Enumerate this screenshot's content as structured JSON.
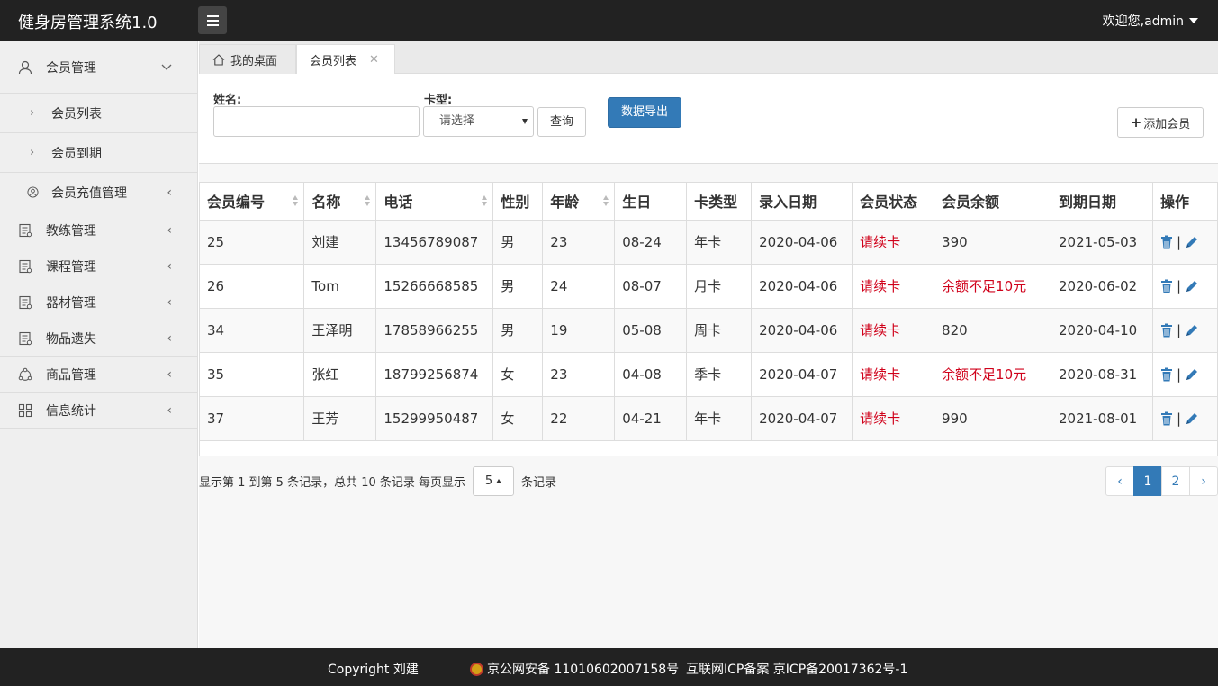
{
  "app": {
    "title": "健身房管理系统1.0",
    "user_greeting": "欢迎您,admin"
  },
  "sidebar": {
    "member": {
      "label": "会员管理",
      "children": [
        "会员列表",
        "会员到期",
        "会员充值管理"
      ]
    },
    "items": [
      {
        "label": "教练管理",
        "icon": "document-icon"
      },
      {
        "label": "课程管理",
        "icon": "document-icon"
      },
      {
        "label": "器材管理",
        "icon": "document-icon"
      },
      {
        "label": "物品遗失",
        "icon": "document-icon"
      },
      {
        "label": "商品管理",
        "icon": "refresh-icon"
      },
      {
        "label": "信息统计",
        "icon": "grid-icon"
      }
    ]
  },
  "tabs": [
    {
      "label": "我的桌面",
      "icon": "home-icon"
    },
    {
      "label": "会员列表",
      "active": true
    }
  ],
  "search": {
    "name_label": "姓名:",
    "name_value": "",
    "card_label": "卡型:",
    "card_selected": "请选择",
    "query_label": "查询",
    "export_label": "数据导出",
    "add_label": "添加会员"
  },
  "table": {
    "columns": [
      "会员编号",
      "名称",
      "电话",
      "性别",
      "年龄",
      "生日",
      "卡类型",
      "录入日期",
      "会员状态",
      "会员余额",
      "到期日期",
      "操作"
    ],
    "rows": [
      {
        "id": "25",
        "name": "刘建",
        "phone": "13456789087",
        "gender": "男",
        "age": "23",
        "birthday": "08-24",
        "card": "年卡",
        "entry": "2020-04-06",
        "status": "请续卡",
        "balance": "390",
        "balance_warn": false,
        "expire": "2021-05-03"
      },
      {
        "id": "26",
        "name": "Tom",
        "phone": "15266668585",
        "gender": "男",
        "age": "24",
        "birthday": "08-07",
        "card": "月卡",
        "entry": "2020-04-06",
        "status": "请续卡",
        "balance": "余额不足10元",
        "balance_warn": true,
        "expire": "2020-06-02"
      },
      {
        "id": "34",
        "name": "王泽明",
        "phone": "17858966255",
        "gender": "男",
        "age": "19",
        "birthday": "05-08",
        "card": "周卡",
        "entry": "2020-04-06",
        "status": "请续卡",
        "balance": "820",
        "balance_warn": false,
        "expire": "2020-04-10"
      },
      {
        "id": "35",
        "name": "张红",
        "phone": "18799256874",
        "gender": "女",
        "age": "23",
        "birthday": "04-08",
        "card": "季卡",
        "entry": "2020-04-07",
        "status": "请续卡",
        "balance": "余额不足10元",
        "balance_warn": true,
        "expire": "2020-08-31"
      },
      {
        "id": "37",
        "name": "王芳",
        "phone": "15299950487",
        "gender": "女",
        "age": "22",
        "birthday": "04-21",
        "card": "年卡",
        "entry": "2020-04-07",
        "status": "请续卡",
        "balance": "990",
        "balance_warn": false,
        "expire": "2021-08-01"
      }
    ]
  },
  "pagination": {
    "info_prefix": "显示第 1 到第 5 条记录，总共 10 条记录 每页显示",
    "page_size": "5",
    "info_suffix": "条记录",
    "prev": "‹",
    "pages": [
      "1",
      "2"
    ],
    "current": "1",
    "next": "›"
  },
  "footer": {
    "copyright": "Copyright 刘建",
    "police": "京公网安备 11010602007158号",
    "icp": "互联网ICP备案 京ICP备20017362号-1"
  },
  "colors": {
    "primary": "#337ab7",
    "warn": "#d0021b",
    "topbar": "#222222"
  }
}
